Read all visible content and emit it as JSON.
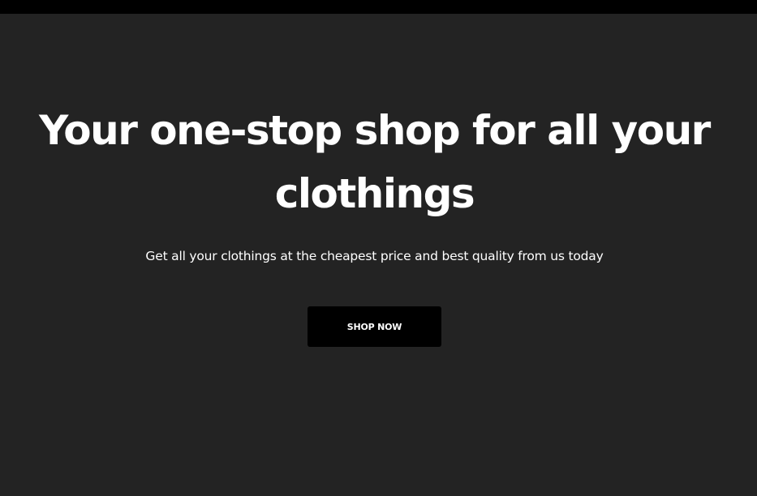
{
  "hero": {
    "title": "Your one-stop shop for all your clothings",
    "subtitle": "Get all your clothings at the cheapest price and best quality from us today",
    "cta_label": "SHOP NOW"
  },
  "colors": {
    "top_bar": "#000000",
    "background": "#232323",
    "text": "#ffffff",
    "button": "#000000"
  }
}
